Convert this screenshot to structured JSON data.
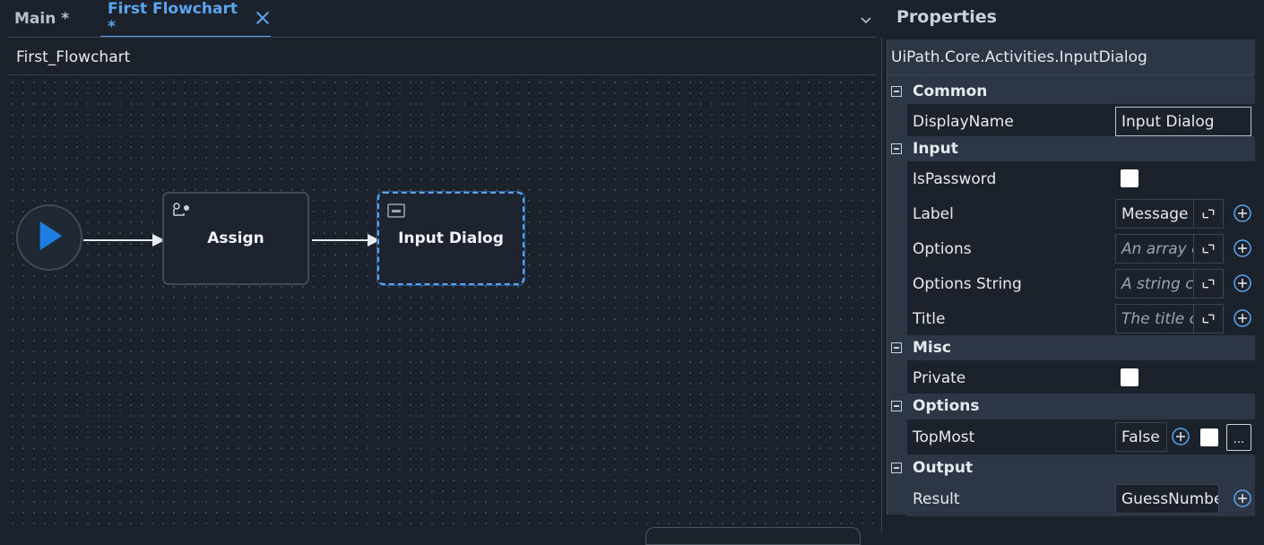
{
  "tabs": [
    {
      "label": "Main *"
    },
    {
      "label": "First Flowchart *"
    }
  ],
  "breadcrumb": "First_Flowchart",
  "flowchart": {
    "nodes": [
      {
        "label": "Assign"
      },
      {
        "label": "Input Dialog"
      }
    ]
  },
  "properties": {
    "title": "Properties",
    "type_name": "UiPath.Core.Activities.InputDialog",
    "categories": {
      "common": "Common",
      "input": "Input",
      "misc": "Misc",
      "options": "Options",
      "output": "Output"
    },
    "rows": {
      "display_name": {
        "label": "DisplayName",
        "value": "Input Dialog"
      },
      "is_password": {
        "label": "IsPassword"
      },
      "label": {
        "label": "Label",
        "value": "Message"
      },
      "options": {
        "label": "Options",
        "placeholder": "An array c"
      },
      "options_string": {
        "label": "Options String",
        "placeholder": "A string c"
      },
      "title": {
        "label": "Title",
        "placeholder": "The title c"
      },
      "private": {
        "label": "Private"
      },
      "top_most": {
        "label": "TopMost",
        "value": "False",
        "more": "..."
      },
      "result": {
        "label": "Result",
        "value": "GuessNumbe"
      }
    }
  },
  "colors": {
    "accent": "#5aa5f0",
    "start_play": "#1a7fe0",
    "background": "#1b222c",
    "panel": "#2c3644"
  }
}
